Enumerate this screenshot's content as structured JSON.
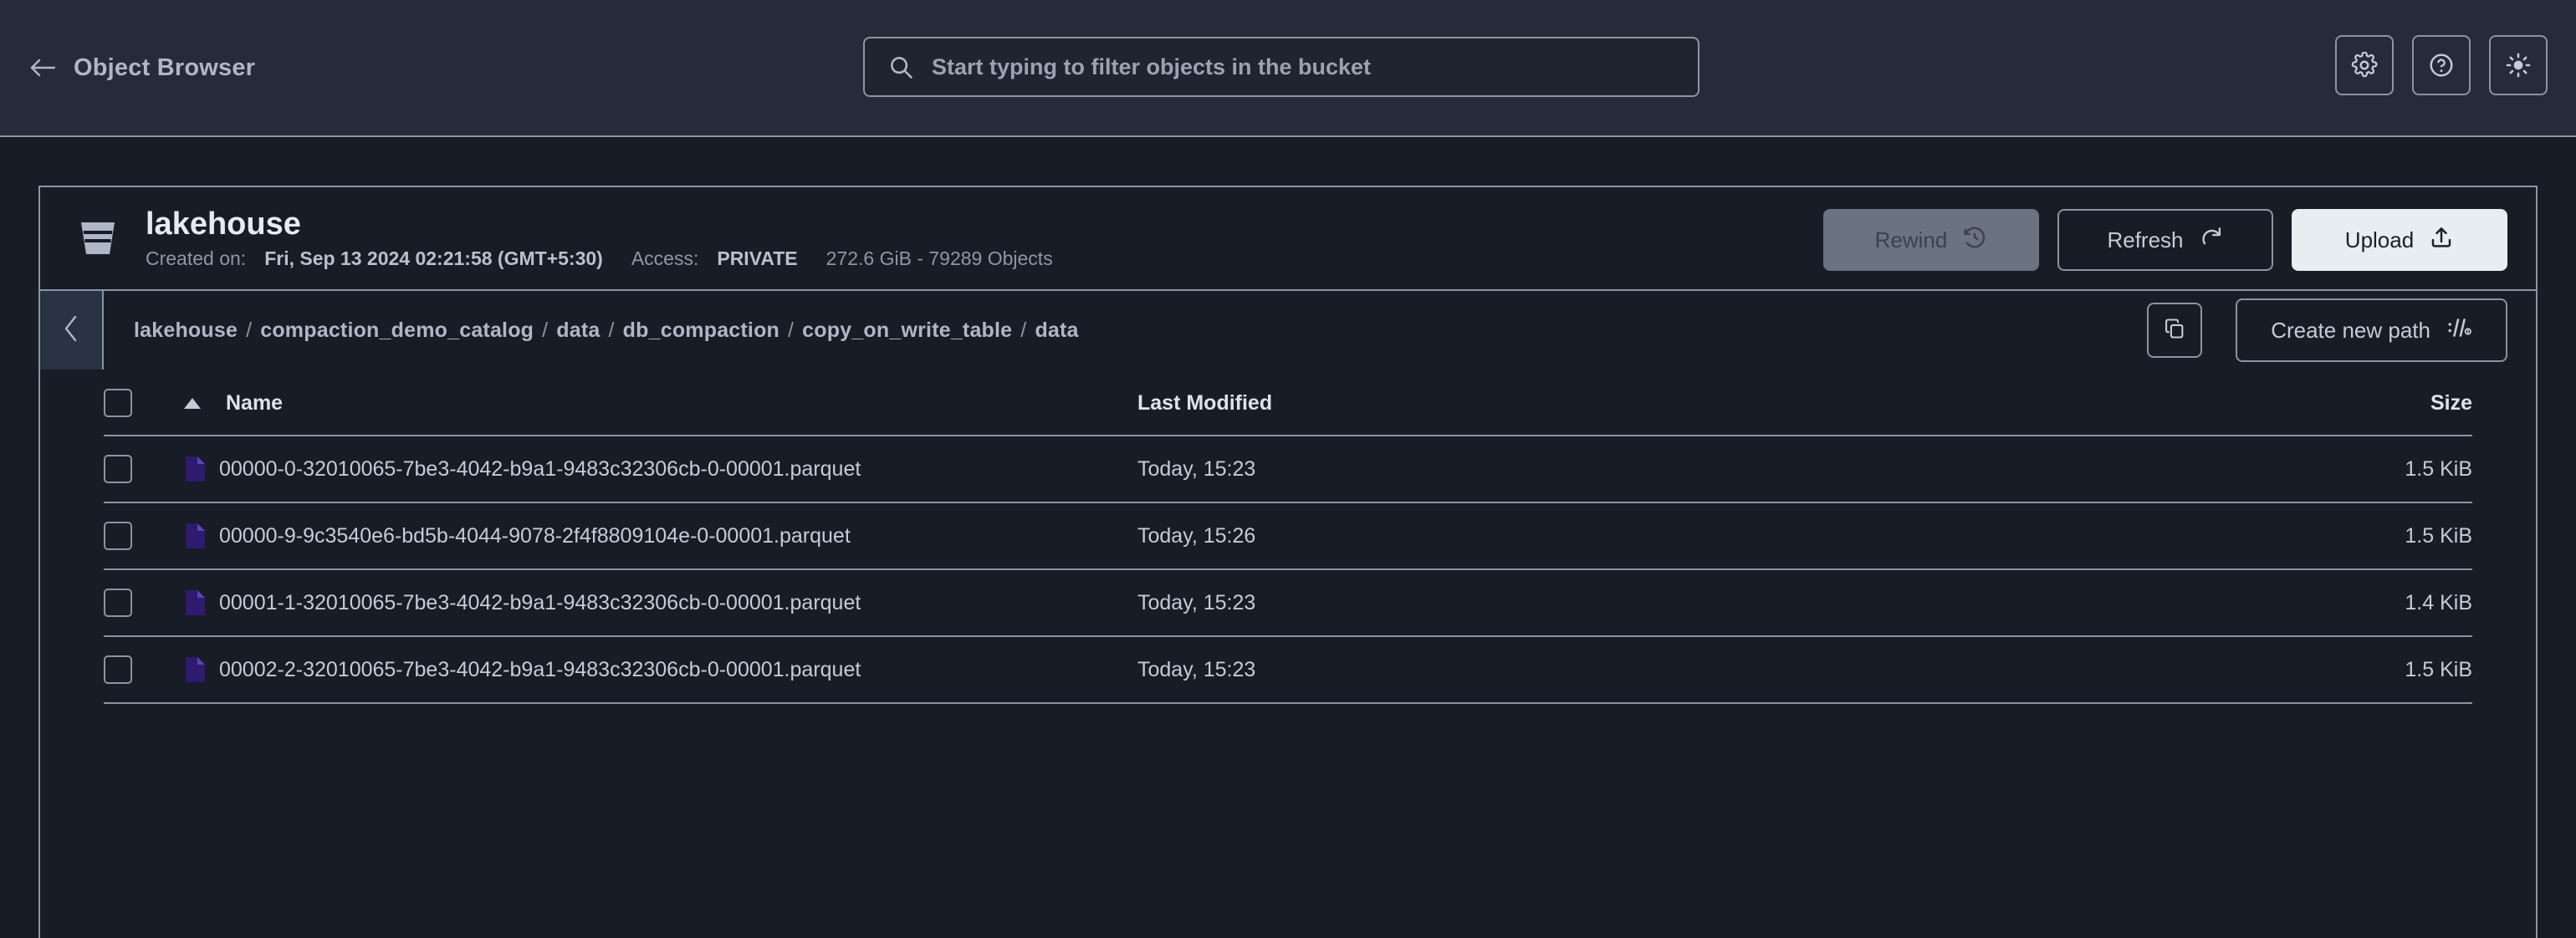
{
  "header": {
    "back_icon": "arrow-left-icon",
    "title": "Object Browser",
    "search": {
      "icon": "search-icon",
      "value": "",
      "placeholder": "Start typing to filter objects in the bucket"
    },
    "actions": [
      {
        "name": "settings-button",
        "icon": "gear-icon"
      },
      {
        "name": "help-button",
        "icon": "question-circle-icon"
      },
      {
        "name": "theme-toggle-button",
        "icon": "sun-icon"
      }
    ]
  },
  "bucket": {
    "icon": "bucket-icon",
    "name": "lakehouse",
    "created_label": "Created on:",
    "created_value": "Fri, Sep 13 2024 02:21:58 (GMT+5:30)",
    "access_label": "Access:",
    "access_value": "PRIVATE",
    "stats": "272.6 GiB - 79289 Objects",
    "actions": {
      "rewind_label": "Rewind",
      "rewind_icon": "rewind-clock-icon",
      "rewind_disabled": true,
      "refresh_label": "Refresh",
      "refresh_icon": "refresh-icon",
      "upload_label": "Upload",
      "upload_icon": "upload-icon"
    }
  },
  "breadcrumb": {
    "back_icon": "chevron-left-icon",
    "separator": "/",
    "items": [
      "lakehouse",
      "compaction_demo_catalog",
      "data",
      "db_compaction",
      "copy_on_write_table",
      "data"
    ],
    "copy_icon": "copy-icon",
    "create_path_label": "Create new path",
    "create_path_icon": "path-icon"
  },
  "table": {
    "columns": {
      "name": "Name",
      "last_modified": "Last Modified",
      "size": "Size"
    },
    "sort": {
      "column": "Name",
      "direction": "asc",
      "icon": "triangle-up-icon"
    },
    "select_all_checked": false,
    "rows": [
      {
        "checked": false,
        "icon": "parquet-file-icon",
        "name": "00000-0-32010065-7be3-4042-b9a1-9483c32306cb-0-00001.parquet",
        "last_modified": "Today, 15:23",
        "size": "1.5 KiB"
      },
      {
        "checked": false,
        "icon": "parquet-file-icon",
        "name": "00000-9-9c3540e6-bd5b-4044-9078-2f4f8809104e-0-00001.parquet",
        "last_modified": "Today, 15:26",
        "size": "1.5 KiB"
      },
      {
        "checked": false,
        "icon": "parquet-file-icon",
        "name": "00001-1-32010065-7be3-4042-b9a1-9483c32306cb-0-00001.parquet",
        "last_modified": "Today, 15:23",
        "size": "1.4 KiB"
      },
      {
        "checked": false,
        "icon": "parquet-file-icon",
        "name": "00002-2-32010065-7be3-4042-b9a1-9483c32306cb-0-00001.parquet",
        "last_modified": "Today, 15:23",
        "size": "1.5 KiB"
      }
    ]
  },
  "colors": {
    "header_bg": "#252B38",
    "body_bg": "#171C26",
    "border": "#8C93A4",
    "text_primary": "#DDE2EC",
    "text_muted": "#8F96A6",
    "accent_upload": "#E8EDF1",
    "disabled_btn": "#6B7280",
    "file_icon": "#2E1A6E"
  }
}
